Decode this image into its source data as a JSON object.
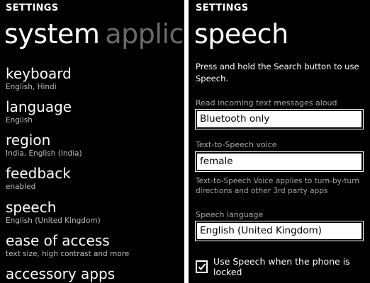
{
  "left": {
    "header": "SETTINGS",
    "pivot_active": "system",
    "pivot_inactive": "applications",
    "items": [
      {
        "title": "keyboard",
        "subtitle": "English, Hindi"
      },
      {
        "title": "language",
        "subtitle": "English"
      },
      {
        "title": "region",
        "subtitle": "India, English (India)"
      },
      {
        "title": "feedback",
        "subtitle": "enabled"
      },
      {
        "title": "speech",
        "subtitle": "English (United Kingdom)"
      },
      {
        "title": "ease of access",
        "subtitle": "text size, high contrast and more"
      },
      {
        "title": "accessory apps",
        "subtitle": ""
      }
    ]
  },
  "right": {
    "header": "SETTINGS",
    "title": "speech",
    "description": "Press and hold the Search button to use Speech.",
    "read_messages": {
      "label": "Read incoming text messages aloud",
      "value": "Bluetooth only"
    },
    "tts_voice": {
      "label": "Text-to-Speech voice",
      "value": "female"
    },
    "tts_note": "Text-to-Speech Voice applies to turn-by-turn directions and other 3rd party apps",
    "speech_language": {
      "label": "Speech language",
      "value": "English (United Kingdom)"
    },
    "locked_option": {
      "label": "Use Speech when the phone is locked",
      "checked": true
    }
  }
}
